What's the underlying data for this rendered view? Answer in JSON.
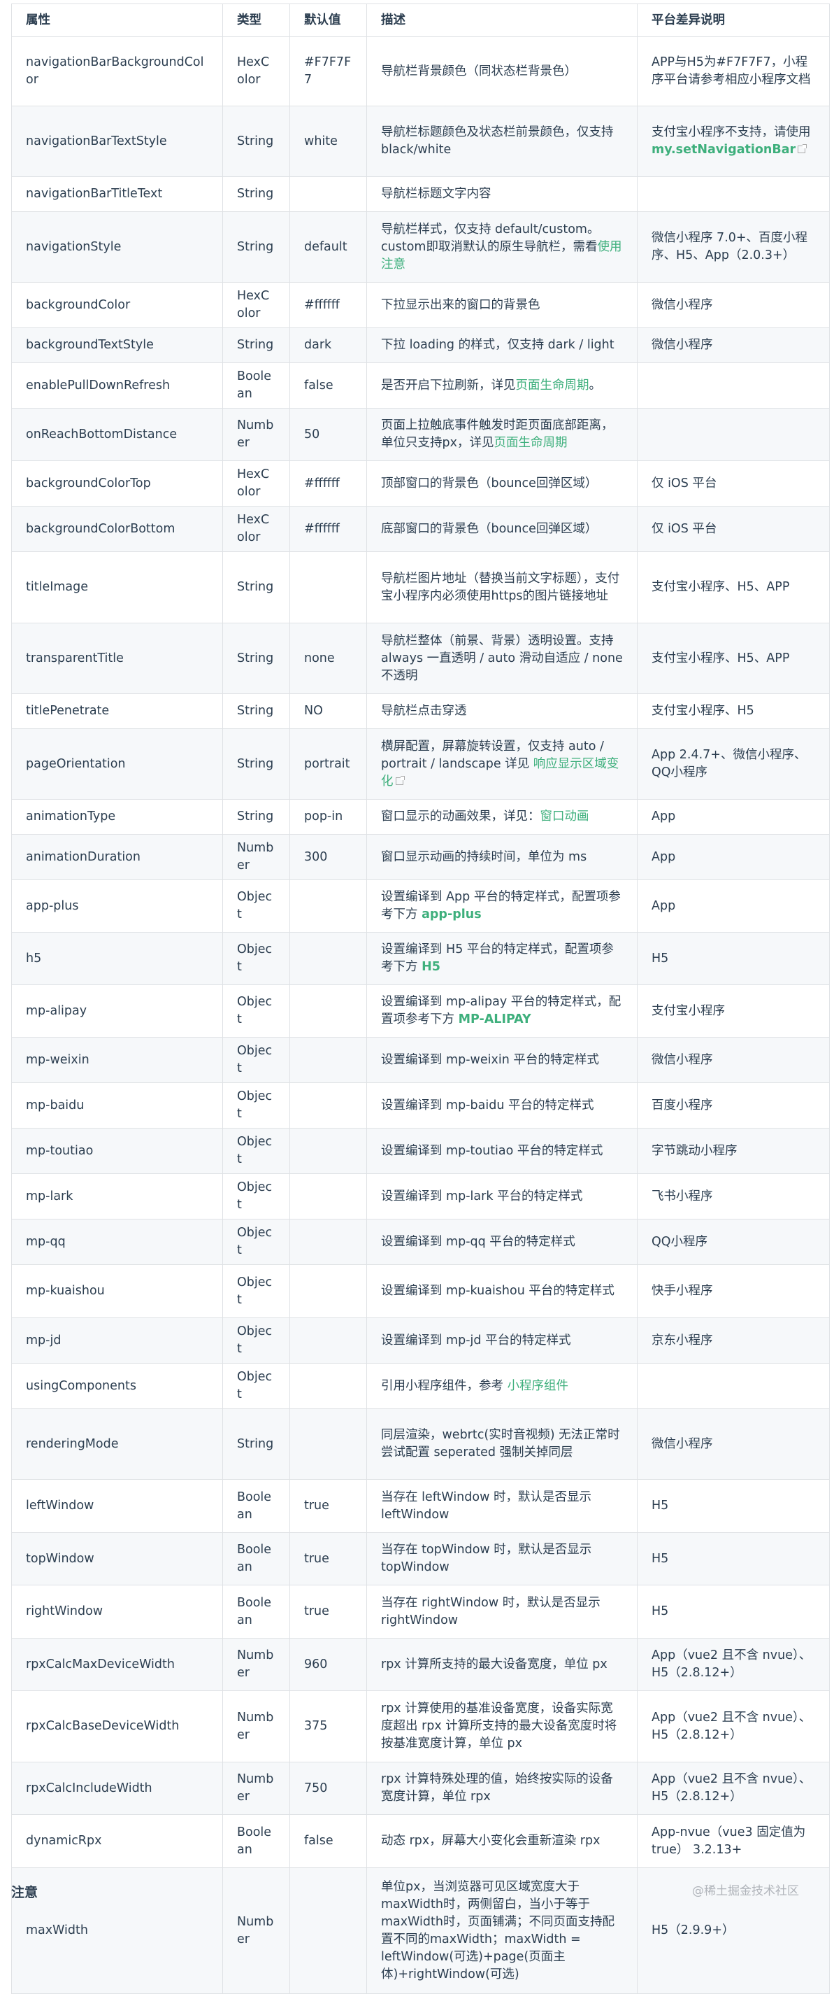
{
  "table": {
    "headers": [
      "属性",
      "类型",
      "默认值",
      "描述",
      "平台差异说明"
    ],
    "rows": [
      {
        "prop": "navigationBarBackgroundColor",
        "type": "HexColor",
        "default": "#F7F7F7",
        "desc": [
          {
            "t": "导航栏背景颜色（同状态栏背景色）"
          }
        ],
        "platform": [
          {
            "t": "APP与H5为#F7F7F7，小程序平台请参考相应小程序文档"
          }
        ],
        "h": 99
      },
      {
        "prop": "navigationBarTextStyle",
        "type": "String",
        "default": "white",
        "desc": [
          {
            "t": "导航栏标题颜色及状态栏前景颜色，仅支持 black/white"
          }
        ],
        "platform": [
          {
            "t": "支付宝小程序不支持，请使用 "
          },
          {
            "t": "my.setNavigationBar",
            "link": true,
            "bold": true,
            "ext": true
          }
        ],
        "h": 101
      },
      {
        "prop": "navigationBarTitleText",
        "type": "String",
        "default": "",
        "desc": [
          {
            "t": "导航栏标题文字内容"
          }
        ],
        "platform": [],
        "h": 50
      },
      {
        "prop": "navigationStyle",
        "type": "String",
        "default": "default",
        "desc": [
          {
            "t": "导航栏样式，仅支持 default/custom。custom即取消默认的原生导航栏，需看"
          },
          {
            "t": "使用注意",
            "link": true
          }
        ],
        "platform": [
          {
            "t": "微信小程序 7.0+、百度小程序、H5、App（2.0.3+）"
          }
        ],
        "h": 101
      },
      {
        "prop": "backgroundColor",
        "type": "HexColor",
        "default": "#ffffff",
        "desc": [
          {
            "t": "下拉显示出来的窗口的背景色"
          }
        ],
        "platform": [
          {
            "t": "微信小程序"
          }
        ],
        "h": 51
      },
      {
        "prop": "backgroundTextStyle",
        "type": "String",
        "default": "dark",
        "desc": [
          {
            "t": "下拉 loading 的样式，仅支持 dark / light"
          }
        ],
        "platform": [
          {
            "t": "微信小程序"
          }
        ],
        "h": 50
      },
      {
        "prop": "enablePullDownRefresh",
        "type": "Boolean",
        "default": "false",
        "desc": [
          {
            "t": "是否开启下拉刷新，详见"
          },
          {
            "t": "页面生命周期",
            "link": true
          },
          {
            "t": "。"
          }
        ],
        "platform": [],
        "h": 51
      },
      {
        "prop": "onReachBottomDistance",
        "type": "Number",
        "default": "50",
        "desc": [
          {
            "t": "页面上拉触底事件触发时距页面底部距离，单位只支持px，详见"
          },
          {
            "t": "页面生命周期",
            "link": true
          }
        ],
        "platform": [],
        "h": 75
      },
      {
        "prop": "backgroundColorTop",
        "type": "HexColor",
        "default": "#ffffff",
        "desc": [
          {
            "t": "顶部窗口的背景色（bounce回弹区域）"
          }
        ],
        "platform": [
          {
            "t": "仅 iOS 平台"
          }
        ],
        "h": 50
      },
      {
        "prop": "backgroundColorBottom",
        "type": "HexColor",
        "default": "#ffffff",
        "desc": [
          {
            "t": "底部窗口的背景色（bounce回弹区域）"
          }
        ],
        "platform": [
          {
            "t": "仅 iOS 平台"
          }
        ],
        "h": 50
      },
      {
        "prop": "titleImage",
        "type": "String",
        "default": "",
        "desc": [
          {
            "t": "导航栏图片地址（替换当前文字标题），支付宝小程序内必须使用https的图片链接地址"
          }
        ],
        "platform": [
          {
            "t": "支付宝小程序、H5、APP"
          }
        ],
        "h": 102
      },
      {
        "prop": "transparentTitle",
        "type": "String",
        "default": "none",
        "desc": [
          {
            "t": "导航栏整体（前景、背景）透明设置。支持 always 一直透明 / auto 滑动自适应 / none 不透明"
          }
        ],
        "platform": [
          {
            "t": "支付宝小程序、H5、APP"
          }
        ],
        "h": 101
      },
      {
        "prop": "titlePenetrate",
        "type": "String",
        "default": "NO",
        "desc": [
          {
            "t": "导航栏点击穿透"
          }
        ],
        "platform": [
          {
            "t": "支付宝小程序、H5"
          }
        ],
        "h": 50
      },
      {
        "prop": "pageOrientation",
        "type": "String",
        "default": "portrait",
        "desc": [
          {
            "t": "横屏配置，屏幕旋转设置，仅支持 auto / portrait / landscape 详见 "
          },
          {
            "t": "响应显示区域变化",
            "link": true,
            "ext": true
          }
        ],
        "platform": [
          {
            "t": "App 2.4.7+、微信小程序、QQ小程序"
          }
        ],
        "h": 101
      },
      {
        "prop": "animationType",
        "type": "String",
        "default": "pop-in",
        "desc": [
          {
            "t": "窗口显示的动画效果，详见："
          },
          {
            "t": "窗口动画",
            "link": true
          }
        ],
        "platform": [
          {
            "t": "App"
          }
        ],
        "h": 50
      },
      {
        "prop": "animationDuration",
        "type": "Number",
        "default": "300",
        "desc": [
          {
            "t": "窗口显示动画的持续时间，单位为 ms"
          }
        ],
        "platform": [
          {
            "t": "App"
          }
        ],
        "h": 51
      },
      {
        "prop": "app-plus",
        "type": "Object",
        "default": "",
        "desc": [
          {
            "t": "设置编译到 App 平台的特定样式，配置项参考下方 "
          },
          {
            "t": "app-plus",
            "link": true,
            "bold": true
          }
        ],
        "platform": [
          {
            "t": "App"
          }
        ],
        "h": 75
      },
      {
        "prop": "h5",
        "type": "Object",
        "default": "",
        "desc": [
          {
            "t": "设置编译到 H5 平台的特定样式，配置项参考下方 "
          },
          {
            "t": "H5",
            "link": true,
            "bold": true
          }
        ],
        "platform": [
          {
            "t": "H5"
          }
        ],
        "h": 75
      },
      {
        "prop": "mp-alipay",
        "type": "Object",
        "default": "",
        "desc": [
          {
            "t": "设置编译到 mp-alipay 平台的特定样式，配置项参考下方 "
          },
          {
            "t": "MP-ALIPAY",
            "link": true,
            "bold": true
          }
        ],
        "platform": [
          {
            "t": "支付宝小程序"
          }
        ],
        "h": 75
      },
      {
        "prop": "mp-weixin",
        "type": "Object",
        "default": "",
        "desc": [
          {
            "t": "设置编译到 mp-weixin 平台的特定样式"
          }
        ],
        "platform": [
          {
            "t": "微信小程序"
          }
        ],
        "h": 51
      },
      {
        "prop": "mp-baidu",
        "type": "Object",
        "default": "",
        "desc": [
          {
            "t": "设置编译到 mp-baidu 平台的特定样式"
          }
        ],
        "platform": [
          {
            "t": "百度小程序"
          }
        ],
        "h": 50
      },
      {
        "prop": "mp-toutiao",
        "type": "Object",
        "default": "",
        "desc": [
          {
            "t": "设置编译到 mp-toutiao 平台的特定样式"
          }
        ],
        "platform": [
          {
            "t": "字节跳动小程序"
          }
        ],
        "h": 50
      },
      {
        "prop": "mp-lark",
        "type": "Object",
        "default": "",
        "desc": [
          {
            "t": "设置编译到 mp-lark 平台的特定样式"
          }
        ],
        "platform": [
          {
            "t": "飞书小程序"
          }
        ],
        "h": 51
      },
      {
        "prop": "mp-qq",
        "type": "Object",
        "default": "",
        "desc": [
          {
            "t": "设置编译到 mp-qq 平台的特定样式"
          }
        ],
        "platform": [
          {
            "t": "QQ小程序"
          }
        ],
        "h": 50
      },
      {
        "prop": "mp-kuaishou",
        "type": "Object",
        "default": "",
        "desc": [
          {
            "t": "设置编译到 mp-kuaishou 平台的特定样式"
          }
        ],
        "platform": [
          {
            "t": "快手小程序"
          }
        ],
        "h": 76
      },
      {
        "prop": "mp-jd",
        "type": "Object",
        "default": "",
        "desc": [
          {
            "t": "设置编译到 mp-jd 平台的特定样式"
          }
        ],
        "platform": [
          {
            "t": "京东小程序"
          }
        ],
        "h": 51
      },
      {
        "prop": "usingComponents",
        "type": "Object",
        "default": "",
        "desc": [
          {
            "t": "引用小程序组件，参考 "
          },
          {
            "t": "小程序组件",
            "link": true
          }
        ],
        "platform": [],
        "h": 50
      },
      {
        "prop": "renderingMode",
        "type": "String",
        "default": "",
        "desc": [
          {
            "t": "同层渲染，webrtc(实时音视频) 无法正常时尝试配置 seperated 强制关掉同层"
          }
        ],
        "platform": [
          {
            "t": "微信小程序"
          }
        ],
        "h": 101
      },
      {
        "prop": "leftWindow",
        "type": "Boolean",
        "default": "true",
        "desc": [
          {
            "t": "当存在 leftWindow 时，默认是否显示 leftWindow"
          }
        ],
        "platform": [
          {
            "t": "H5"
          }
        ],
        "h": 76
      },
      {
        "prop": "topWindow",
        "type": "Boolean",
        "default": "true",
        "desc": [
          {
            "t": "当存在 topWindow 时，默认是否显示 topWindow"
          }
        ],
        "platform": [
          {
            "t": "H5"
          }
        ],
        "h": 75
      },
      {
        "prop": "rightWindow",
        "type": "Boolean",
        "default": "true",
        "desc": [
          {
            "t": "当存在 rightWindow 时，默认是否显示 rightWindow"
          }
        ],
        "platform": [
          {
            "t": "H5"
          }
        ],
        "h": 76
      },
      {
        "prop": "rpxCalcMaxDeviceWidth",
        "type": "Number",
        "default": "960",
        "desc": [
          {
            "t": "rpx 计算所支持的最大设备宽度，单位 px"
          }
        ],
        "platform": [
          {
            "t": "App（vue2 且不含 nvue）、H5（2.8.12+）"
          }
        ],
        "h": 75
      },
      {
        "prop": "rpxCalcBaseDeviceWidth",
        "type": "Number",
        "default": "375",
        "desc": [
          {
            "t": "rpx 计算使用的基准设备宽度，设备实际宽度超出 rpx 计算所支持的最大设备宽度时将按基准宽度计算，单位 px"
          }
        ],
        "platform": [
          {
            "t": "App（vue2 且不含 nvue）、H5（2.8.12+）"
          }
        ],
        "h": 102
      },
      {
        "prop": "rpxCalcIncludeWidth",
        "type": "Number",
        "default": "750",
        "desc": [
          {
            "t": "rpx 计算特殊处理的值，始终按实际的设备宽度计算，单位 rpx"
          }
        ],
        "platform": [
          {
            "t": "App（vue2 且不含 nvue）、H5（2.8.12+）"
          }
        ],
        "h": 75
      },
      {
        "prop": "dynamicRpx",
        "type": "Boolean",
        "default": "false",
        "desc": [
          {
            "t": "动态 rpx，屏幕大小变化会重新渲染 rpx"
          }
        ],
        "platform": [
          {
            "t": "App-nvue（vue3 固定值为 true） 3.2.13+"
          }
        ],
        "h": 76
      },
      {
        "prop": "maxWidth",
        "type": "Number",
        "default": "",
        "desc": [
          {
            "t": "单位px，当浏览器可见区域宽度大于maxWidth时，两侧留白，当小于等于maxWidth时，页面铺满；不同页面支持配置不同的maxWidth；maxWidth = leftWindow(可选)+page(页面主体)+rightWindow(可选)"
          }
        ],
        "platform": [
          {
            "t": "H5（2.9.9+）"
          }
        ],
        "h": 180
      }
    ]
  },
  "note_heading": "注意",
  "watermark": "@稀土掘金技术社区",
  "colors": {
    "link": "#3eaf7c",
    "border": "#dfe2e5",
    "stripe": "#f6f8fa",
    "text": "#2c3e50"
  }
}
